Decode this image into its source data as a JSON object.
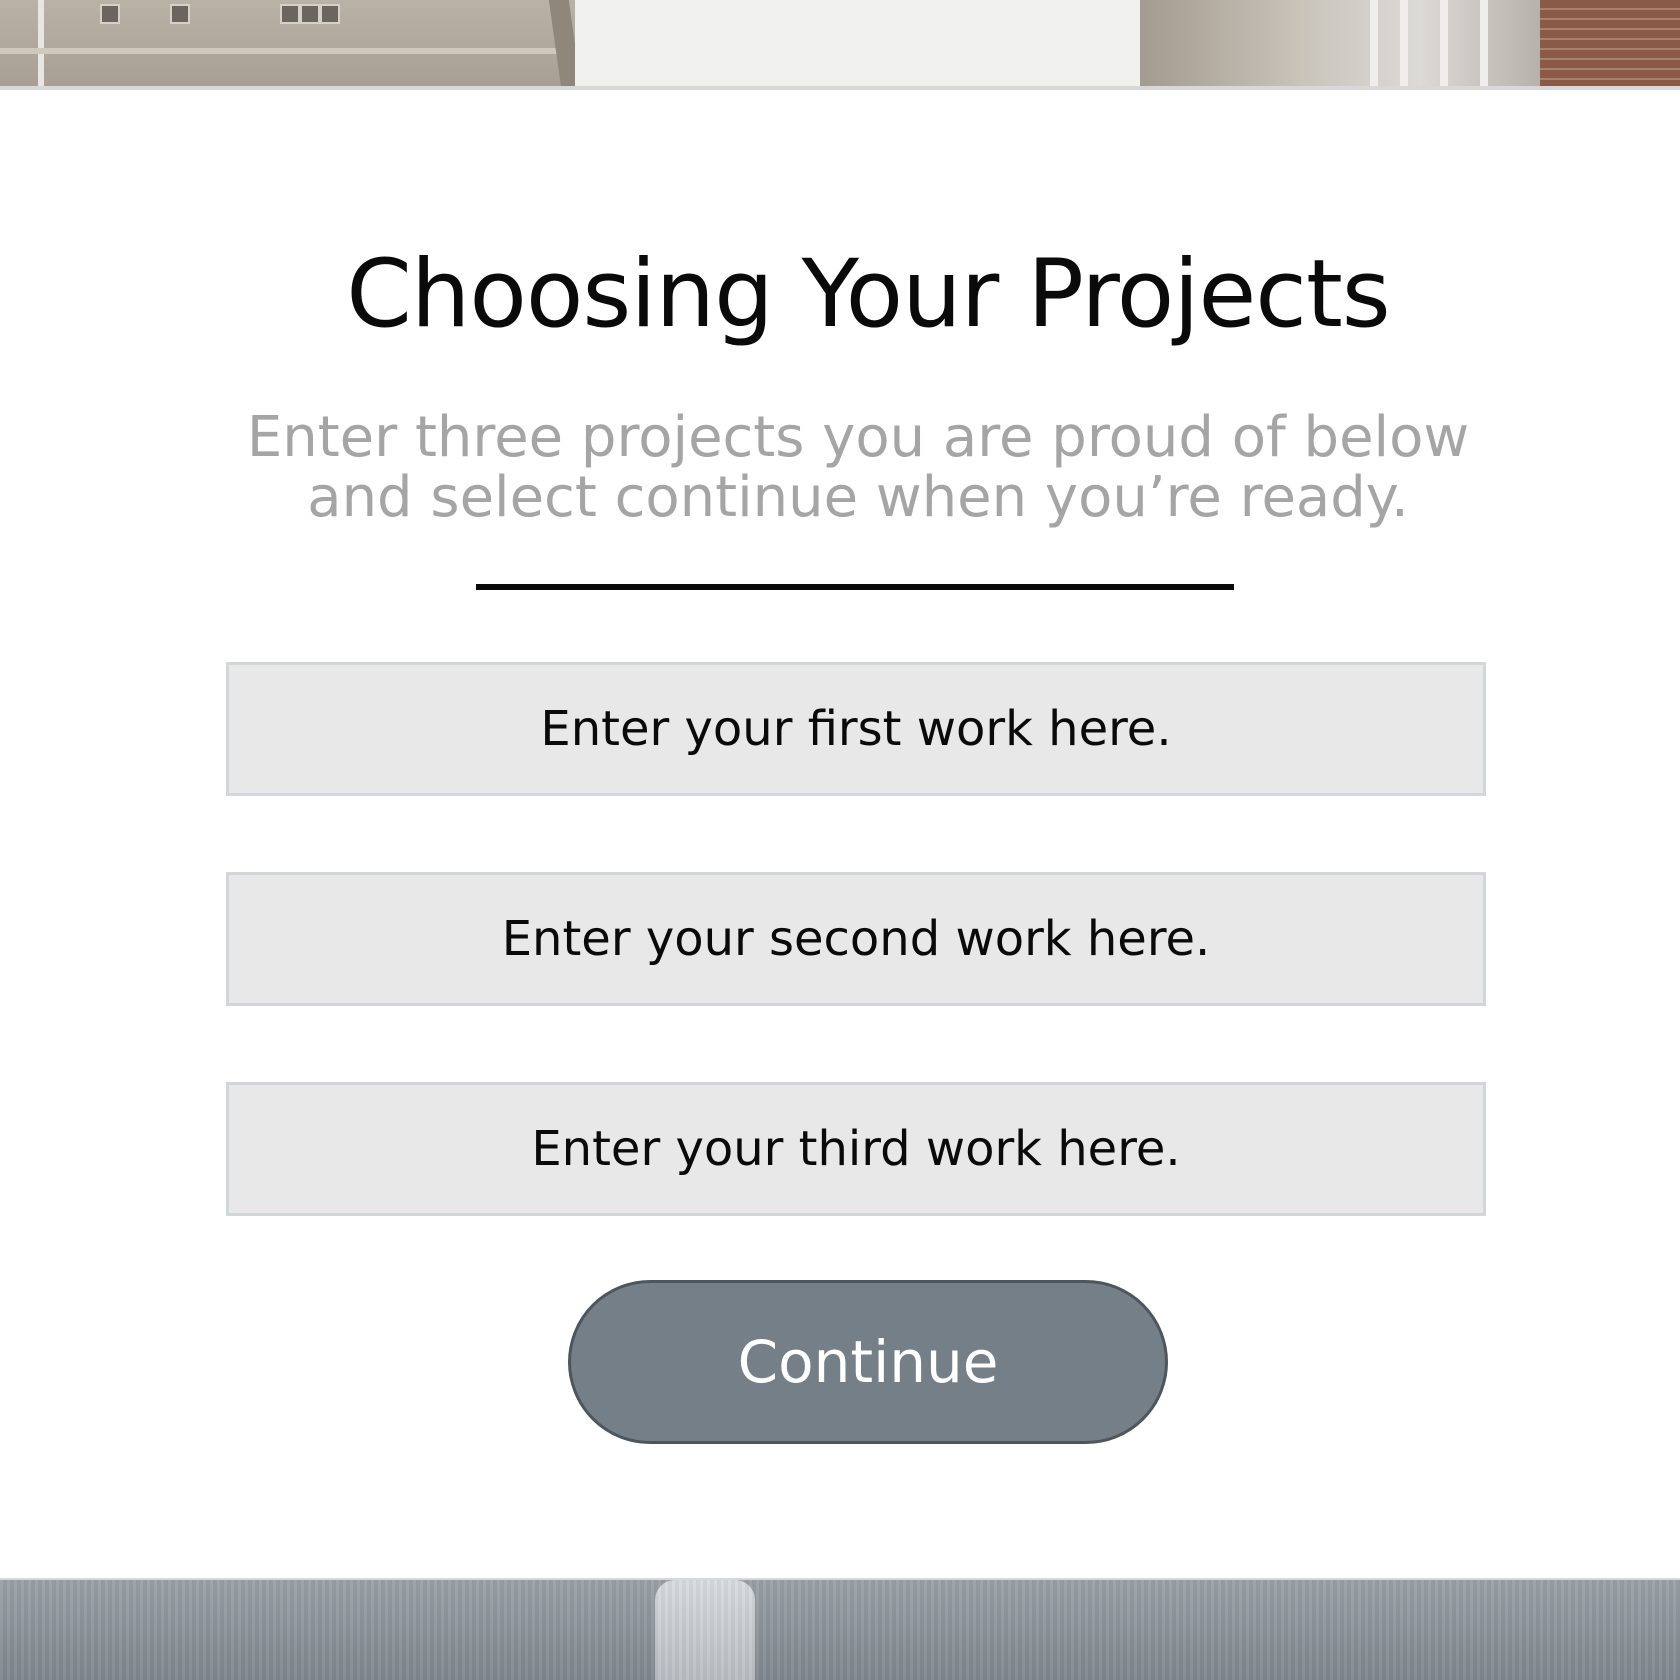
{
  "modal": {
    "title": "Choosing Your Projects",
    "subtitle": "Enter three projects you are proud of below and select continue when you’re ready.",
    "fields": [
      {
        "placeholder": "Enter your first work here.",
        "value": ""
      },
      {
        "placeholder": "Enter your second work here.",
        "value": ""
      },
      {
        "placeholder": "Enter your third work here.",
        "value": ""
      }
    ],
    "continue_label": "Continue"
  },
  "colors": {
    "title": "#0a0a0a",
    "subtitle": "#a5a5a5",
    "field_background": "#e8e8e8",
    "field_border": "#d0d6dc",
    "button_background": "#757f87",
    "button_border": "#4d565d",
    "button_text": "#ffffff"
  }
}
